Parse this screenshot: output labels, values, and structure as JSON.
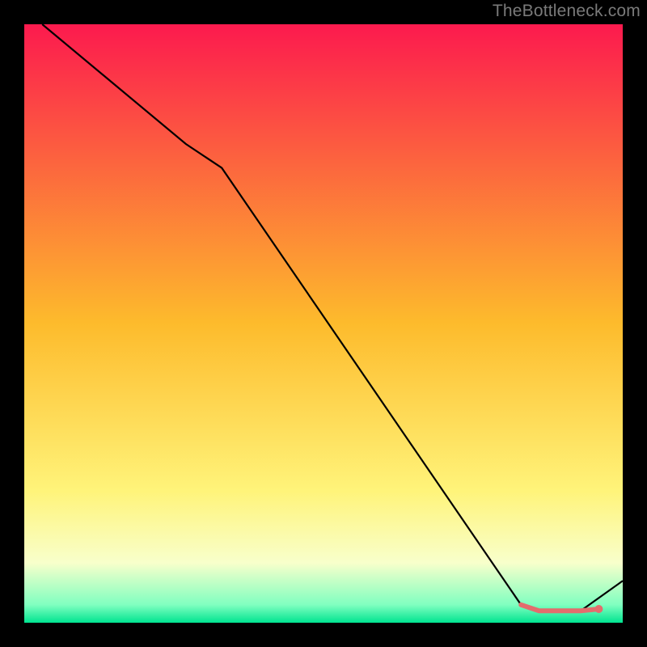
{
  "watermark": "TheBottleneck.com",
  "chart_data": {
    "type": "line",
    "title": "",
    "xlabel": "",
    "ylabel": "",
    "xlim": [
      0,
      100
    ],
    "ylim": [
      0,
      100
    ],
    "legend": false,
    "grid": false,
    "background_gradient": {
      "type": "vertical",
      "stops": [
        {
          "pos": 0.0,
          "color": "#fc1a4e"
        },
        {
          "pos": 0.5,
          "color": "#fdbb2c"
        },
        {
          "pos": 0.78,
          "color": "#fff47a"
        },
        {
          "pos": 0.9,
          "color": "#f8ffcb"
        },
        {
          "pos": 0.97,
          "color": "#80ffc0"
        },
        {
          "pos": 1.0,
          "color": "#00e490"
        }
      ]
    },
    "series": [
      {
        "name": "bottleneck-curve",
        "color": "#000000",
        "width": 2.2,
        "x": [
          3,
          15,
          27,
          33,
          83,
          86,
          93,
          100
        ],
        "y": [
          100,
          90,
          80,
          76,
          3,
          2,
          2,
          7
        ]
      }
    ],
    "highlight": {
      "name": "optimal-range",
      "color": "#e36d6d",
      "width": 6,
      "x": [
        83,
        86,
        93,
        96
      ],
      "y": [
        3,
        2,
        2,
        2.3
      ],
      "end_dot": {
        "x": 96,
        "y": 2.3,
        "r": 5
      }
    }
  }
}
